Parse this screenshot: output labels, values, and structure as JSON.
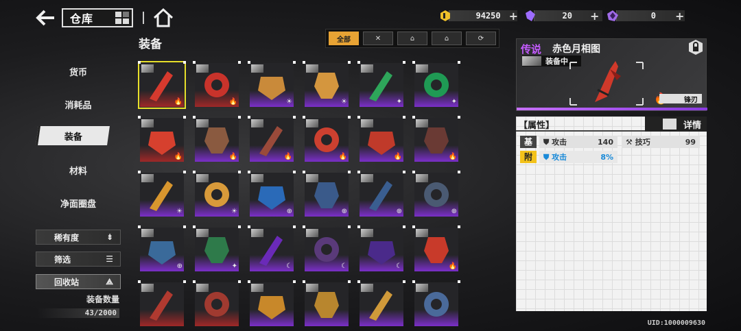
{
  "header": {
    "title": "仓库",
    "currencies": [
      {
        "icon": "gold-coin-icon",
        "value": "94250",
        "color": "#f0c12a"
      },
      {
        "icon": "purple-crystal-icon",
        "value": "20",
        "color": "#9d6cff"
      },
      {
        "icon": "dark-crystal-icon",
        "value": "0",
        "color": "#a06be8"
      }
    ]
  },
  "sidebar": {
    "items": [
      {
        "label": "货币"
      },
      {
        "label": "消耗品"
      },
      {
        "label": "装备"
      },
      {
        "label": "材料"
      },
      {
        "label": "净面圈盘"
      }
    ],
    "sort_label": "稀有度",
    "filter_label": "筛选",
    "recycle_label": "回收站",
    "count_label": "装备数量",
    "count_value": "43/2000"
  },
  "main": {
    "section_title": "装备",
    "filter_tabs": [
      "全部",
      "✕",
      "⌂",
      "⌂",
      "⟳"
    ],
    "items": [
      {
        "color": "#d63a2e",
        "rarity": "legend",
        "selected": true,
        "badge": "🔥"
      },
      {
        "color": "#c8332b",
        "rarity": "legend",
        "badge": "🔥"
      },
      {
        "color": "#c98a3a",
        "rarity": "epic",
        "badge": "☀"
      },
      {
        "color": "#d4963e",
        "rarity": "epic",
        "badge": "☀"
      },
      {
        "color": "#2ea65a",
        "rarity": "epic",
        "badge": "✦"
      },
      {
        "color": "#1f9a54",
        "rarity": "epic",
        "badge": "✦"
      },
      {
        "color": "#d6402e",
        "rarity": "legend",
        "badge": "🔥"
      },
      {
        "color": "#8a5a40",
        "rarity": "epic",
        "badge": "🔥"
      },
      {
        "color": "#9a4a3a",
        "rarity": "epic",
        "badge": "🔥"
      },
      {
        "color": "#cc4030",
        "rarity": "epic",
        "badge": "🔥"
      },
      {
        "color": "#c03a2a",
        "rarity": "epic",
        "badge": "🔥"
      },
      {
        "color": "#6a3a34",
        "rarity": "epic",
        "badge": "🔥"
      },
      {
        "color": "#d8962e",
        "rarity": "epic",
        "badge": "☀"
      },
      {
        "color": "#d89a3a",
        "rarity": "epic",
        "badge": "☀"
      },
      {
        "color": "#2a6ab8",
        "rarity": "epic",
        "badge": "⊕"
      },
      {
        "color": "#3a5a8a",
        "rarity": "epic",
        "badge": "⊕"
      },
      {
        "color": "#3a5e90",
        "rarity": "epic",
        "badge": "⊕"
      },
      {
        "color": "#4a5a72",
        "rarity": "epic",
        "badge": "⊕"
      },
      {
        "color": "#3a6a9a",
        "rarity": "epic",
        "badge": "⊕"
      },
      {
        "color": "#2e7a4a",
        "rarity": "epic",
        "badge": "✦"
      },
      {
        "color": "#6a2ab8",
        "rarity": "epic",
        "badge": "☾"
      },
      {
        "color": "#5a3a7a",
        "rarity": "epic",
        "badge": "☾"
      },
      {
        "color": "#4a2a8a",
        "rarity": "epic",
        "badge": "☾"
      },
      {
        "color": "#c83a2a",
        "rarity": "epic",
        "badge": "🔥"
      },
      {
        "color": "#b03a30",
        "rarity": "legend",
        "badge": ""
      },
      {
        "color": "#a03a30",
        "rarity": "legend",
        "badge": ""
      },
      {
        "color": "#c8882a",
        "rarity": "epic",
        "badge": ""
      },
      {
        "color": "#b8862e",
        "rarity": "epic",
        "badge": ""
      },
      {
        "color": "#d09a3a",
        "rarity": "epic",
        "badge": ""
      },
      {
        "color": "#4a6a9a",
        "rarity": "epic",
        "badge": ""
      }
    ]
  },
  "detail": {
    "rarity": "传说",
    "name": "赤色月相图",
    "equipped": "装备中",
    "type": "锋刃",
    "attributes_label": "【属性】",
    "details_button": "详情",
    "base_tag": "基",
    "sub_tag": "附",
    "base_stats": [
      {
        "name": "攻击",
        "value": "140",
        "icon": "attack-icon"
      },
      {
        "name": "技巧",
        "value": "99",
        "icon": "skill-icon"
      }
    ],
    "sub_stats": [
      {
        "name": "攻击",
        "value": "8%",
        "icon": "attack-icon"
      }
    ]
  },
  "footer": {
    "uid": "UID:1000009630"
  }
}
